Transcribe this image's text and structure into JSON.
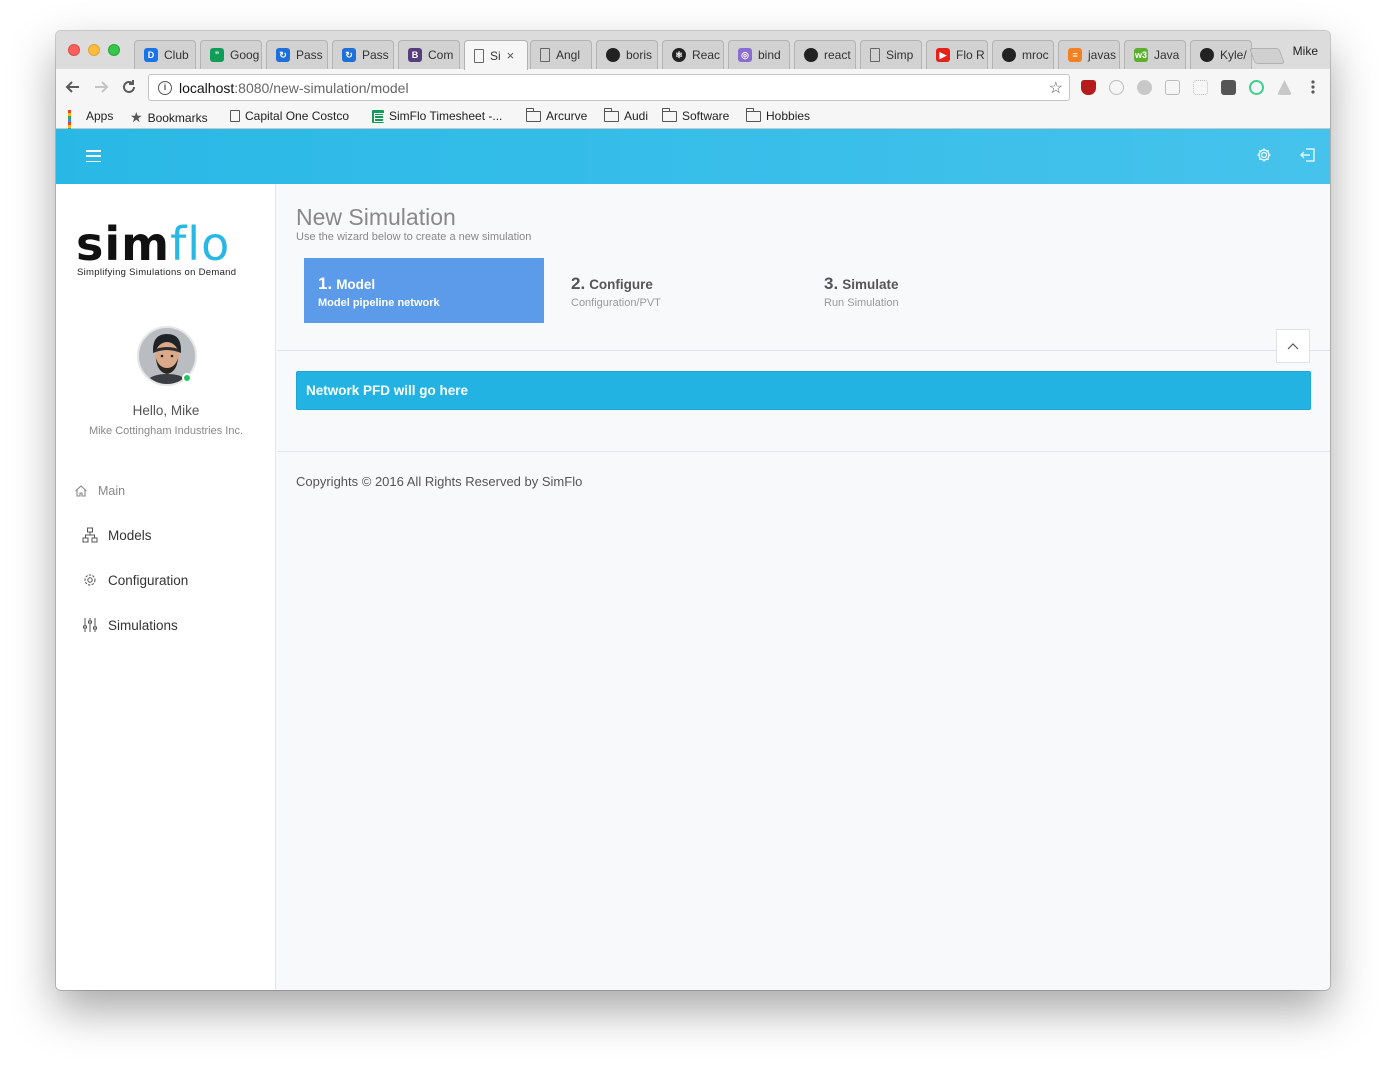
{
  "browser": {
    "profile_name": "Mike",
    "tabs": [
      {
        "label": "Club",
        "fav_color": "#1a73e8",
        "fav_text": "D"
      },
      {
        "label": "Goog",
        "fav_color": "#0f9d58",
        "fav_text": "”"
      },
      {
        "label": "Pass",
        "fav_color": "#1e6fd9",
        "fav_text": "↻"
      },
      {
        "label": "Pass",
        "fav_color": "#1e6fd9",
        "fav_text": "↻"
      },
      {
        "label": "Com",
        "fav_color": "#563d7c",
        "fav_text": "B"
      },
      {
        "label": "Si",
        "fav_color": "#ffffff",
        "fav_text": ""
      },
      {
        "label": "Angl",
        "fav_color": "#ffffff",
        "fav_text": ""
      },
      {
        "label": "boris",
        "fav_color": "#222222",
        "fav_text": ""
      },
      {
        "label": "Reac",
        "fav_color": "#222222",
        "fav_text": "⚛"
      },
      {
        "label": "bind",
        "fav_color": "#8a6bd1",
        "fav_text": "◎"
      },
      {
        "label": "react",
        "fav_color": "#222222",
        "fav_text": ""
      },
      {
        "label": "Simp",
        "fav_color": "#ffffff",
        "fav_text": ""
      },
      {
        "label": "Flo R",
        "fav_color": "#e62117",
        "fav_text": "▶"
      },
      {
        "label": "mroc",
        "fav_color": "#222222",
        "fav_text": ""
      },
      {
        "label": "javas",
        "fav_color": "#f48024",
        "fav_text": "≡"
      },
      {
        "label": "Java",
        "fav_color": "#5bb030",
        "fav_text": "w3"
      },
      {
        "label": "Kyle/",
        "fav_color": "#222222",
        "fav_text": ""
      }
    ],
    "active_tab_close": "×",
    "url_host": "localhost",
    "url_path": ":8080/new-simulation/model",
    "bookmarks": [
      {
        "label": "Apps",
        "icon": "apps-grid-icon"
      },
      {
        "label": "Bookmarks",
        "icon": "star-icon"
      },
      {
        "label": "Capital One Costco",
        "icon": "page-icon"
      },
      {
        "label": "SimFlo Timesheet -...",
        "icon": "sheets-icon"
      },
      {
        "label": "Arcurve",
        "icon": "folder-icon"
      },
      {
        "label": "Audi",
        "icon": "folder-icon"
      },
      {
        "label": "Software",
        "icon": "folder-icon"
      },
      {
        "label": "Hobbies",
        "icon": "folder-icon"
      }
    ]
  },
  "app": {
    "logo": {
      "part1": "sim",
      "part2": "flo",
      "tagline": "Simplifying Simulations on Demand"
    },
    "colors": {
      "header": "#29b8e6",
      "active_step": "#5b9bea",
      "alert": "#22b3e3",
      "online": "#22c55e"
    },
    "user": {
      "greeting": "Hello, Mike",
      "company": "Mike Cottingham Industries Inc."
    },
    "nav": {
      "section": "Main",
      "items": [
        {
          "label": "Models",
          "icon": "sitemap-icon"
        },
        {
          "label": "Configuration",
          "icon": "gear-icon"
        },
        {
          "label": "Simulations",
          "icon": "sliders-icon"
        }
      ]
    },
    "page": {
      "title": "New Simulation",
      "subtitle": "Use the wizard below to create a new simulation",
      "steps": [
        {
          "num": "1.",
          "title": "Model",
          "subtitle": "Model pipeline network",
          "active": true
        },
        {
          "num": "2.",
          "title": "Configure",
          "subtitle": "Configuration/PVT",
          "active": false
        },
        {
          "num": "3.",
          "title": "Simulate",
          "subtitle": "Run Simulation",
          "active": false
        }
      ],
      "alert_text": "Network PFD will go here",
      "footer": "Copyrights © 2016 All Rights Reserved by SimFlo"
    }
  }
}
